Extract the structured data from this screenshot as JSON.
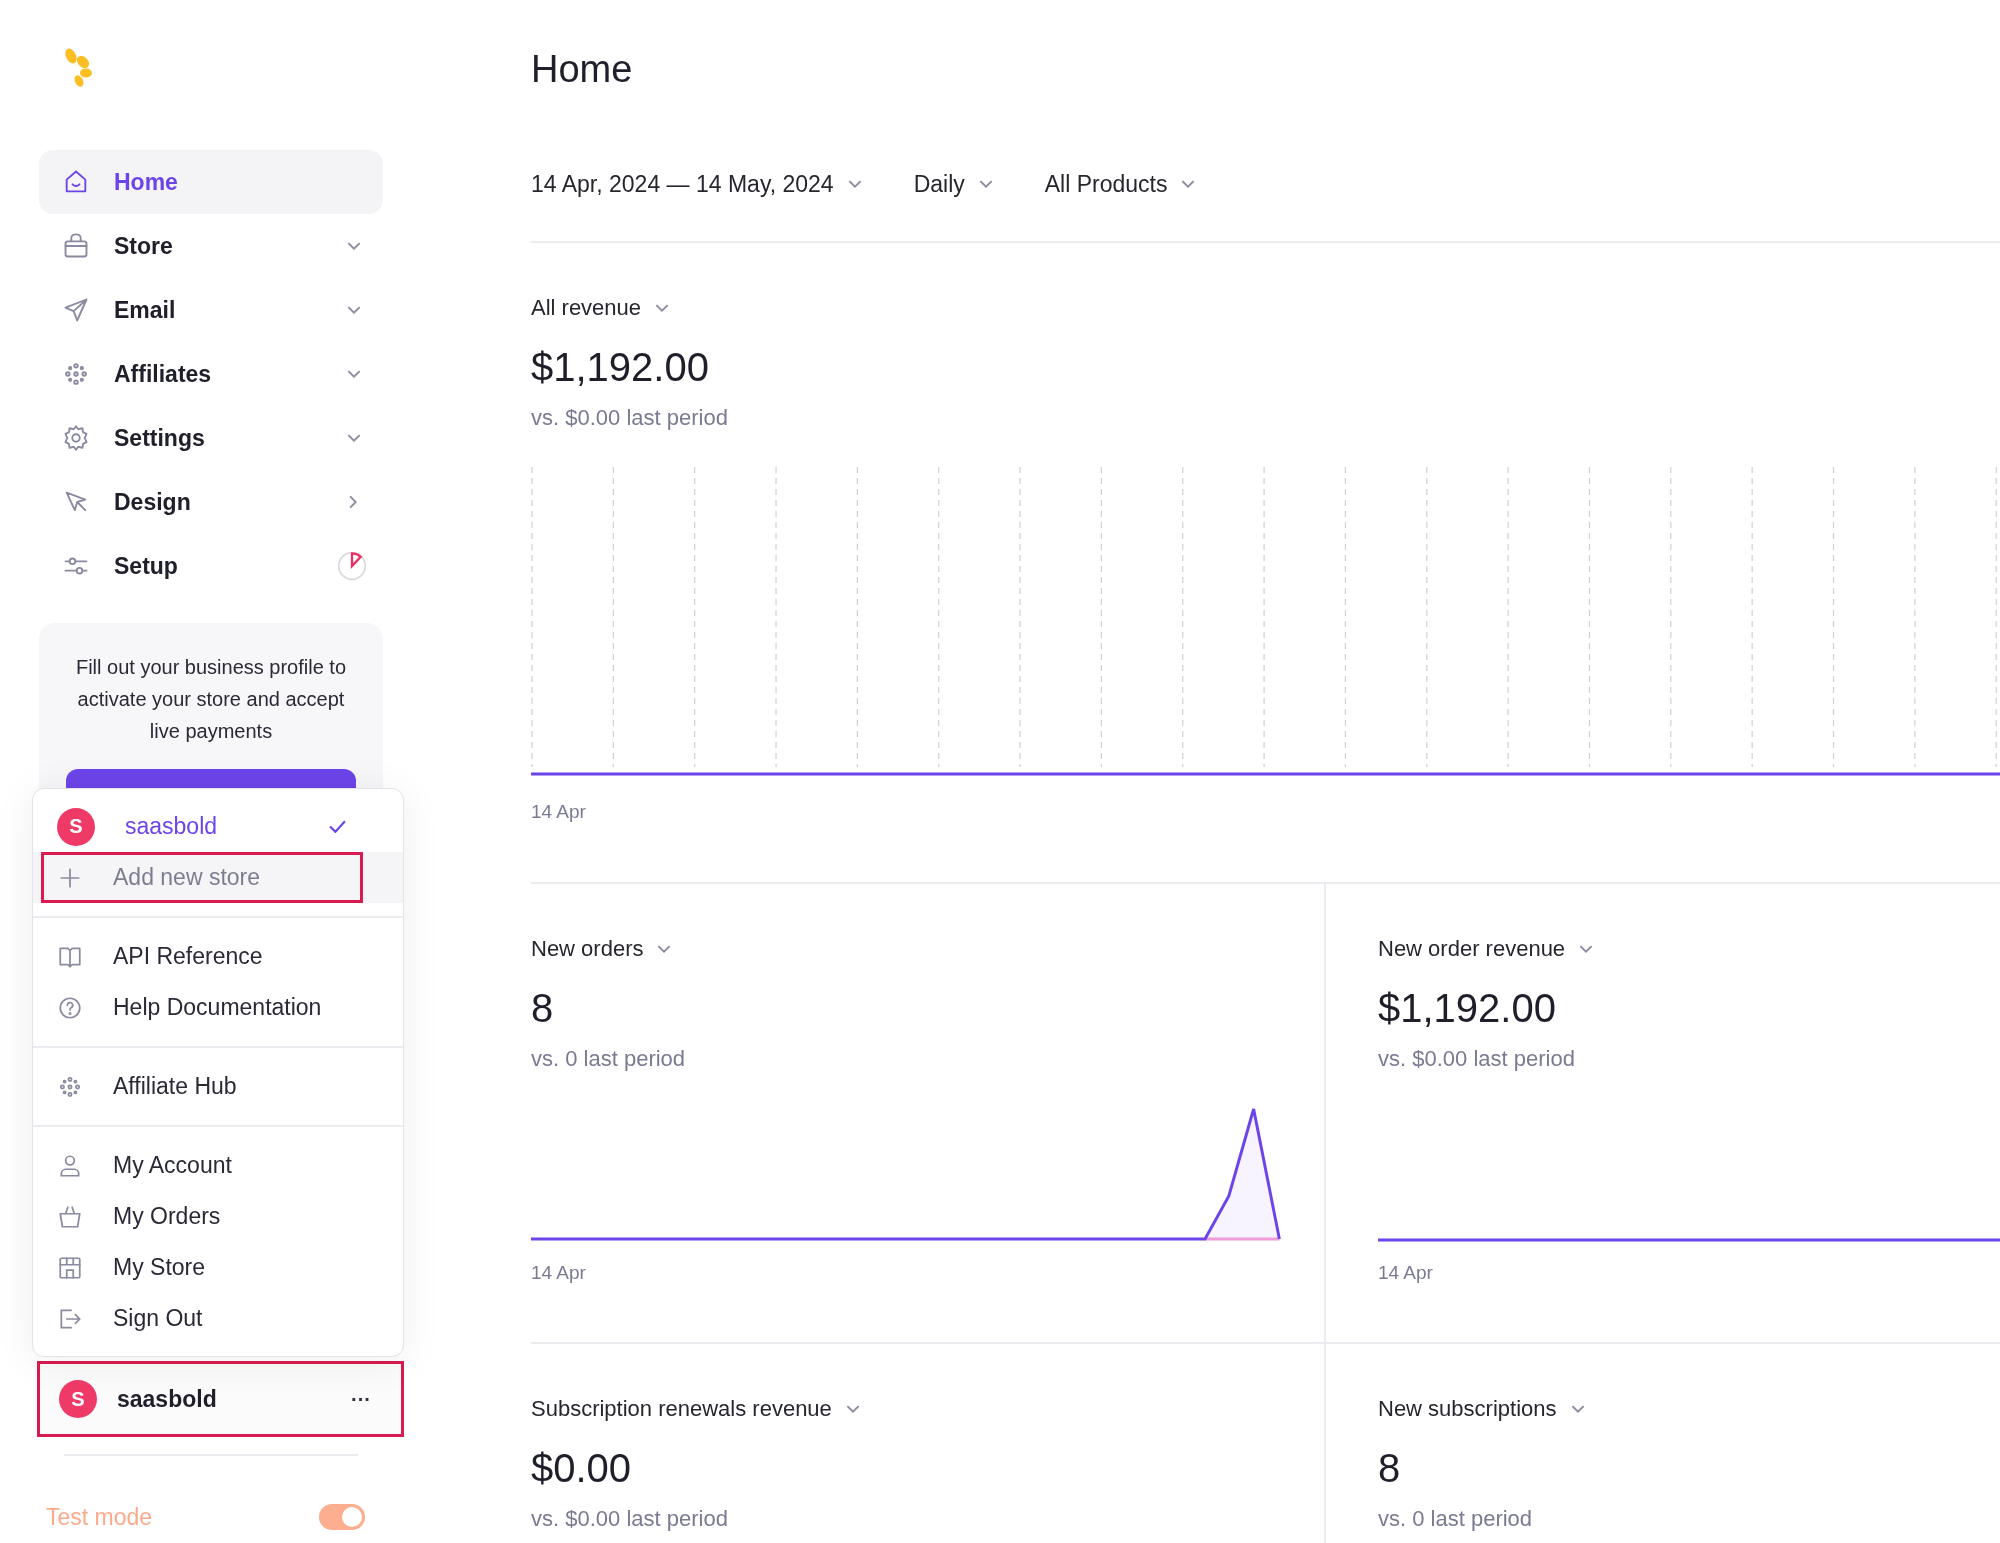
{
  "nav": [
    {
      "label": "Home",
      "selected": true,
      "kind": "plain"
    },
    {
      "label": "Store",
      "selected": false,
      "kind": "expandable"
    },
    {
      "label": "Email",
      "selected": false,
      "kind": "expandable"
    },
    {
      "label": "Affiliates",
      "selected": false,
      "kind": "expandable"
    },
    {
      "label": "Settings",
      "selected": false,
      "kind": "expandable"
    },
    {
      "label": "Design",
      "selected": false,
      "kind": "link"
    },
    {
      "label": "Setup",
      "selected": false,
      "kind": "progress"
    }
  ],
  "promo": {
    "text": "Fill out your business profile to activate your store and accept live payments"
  },
  "account_menu": {
    "groups": [
      {
        "items": [
          {
            "kind": "store",
            "avatar": "S",
            "label": "saasbold",
            "selected": true,
            "highlighted": false
          },
          {
            "kind": "action",
            "label": "Add new store",
            "selected": false,
            "highlighted": true
          }
        ]
      },
      {
        "items": [
          {
            "kind": "link",
            "label": "API Reference",
            "selected": false,
            "highlighted": false
          },
          {
            "kind": "link",
            "label": "Help Documentation",
            "selected": false,
            "highlighted": false
          }
        ]
      },
      {
        "items": [
          {
            "kind": "link",
            "label": "Affiliate Hub",
            "selected": false,
            "highlighted": false
          }
        ]
      },
      {
        "items": [
          {
            "kind": "link",
            "label": "My Account",
            "selected": false,
            "highlighted": false
          },
          {
            "kind": "link",
            "label": "My Orders",
            "selected": false,
            "highlighted": false
          },
          {
            "kind": "link",
            "label": "My Store",
            "selected": false,
            "highlighted": false
          },
          {
            "kind": "link",
            "label": "Sign Out",
            "selected": false,
            "highlighted": false
          }
        ]
      }
    ]
  },
  "account": {
    "avatar": "S",
    "name": "saasbold",
    "more": "···",
    "highlighted": true
  },
  "test_mode": {
    "label": "Test mode",
    "on": true
  },
  "page": {
    "title": "Home"
  },
  "filters": [
    {
      "label": "14 Apr, 2024 — 14 May, 2024"
    },
    {
      "label": "Daily"
    },
    {
      "label": "All Products"
    }
  ],
  "main_metric": {
    "label": "All revenue",
    "value": "$1,192.00",
    "comparison": "vs. $0.00 last period",
    "axis_label": "14 Apr",
    "kind": "flat"
  },
  "metrics": [
    {
      "label": "New orders",
      "value": "8",
      "comparison": "vs. 0 last period",
      "axis_label": "14 Apr",
      "kind": "spike"
    },
    {
      "label": "New order revenue",
      "value": "$1,192.00",
      "comparison": "vs. $0.00 last period",
      "axis_label": "14 Apr",
      "kind": "flat"
    },
    {
      "label": "Subscription renewals revenue",
      "value": "$0.00",
      "comparison": "vs. $0.00 last period"
    },
    {
      "label": "New subscriptions",
      "value": "8",
      "comparison": "vs. 0 last period"
    }
  ]
}
